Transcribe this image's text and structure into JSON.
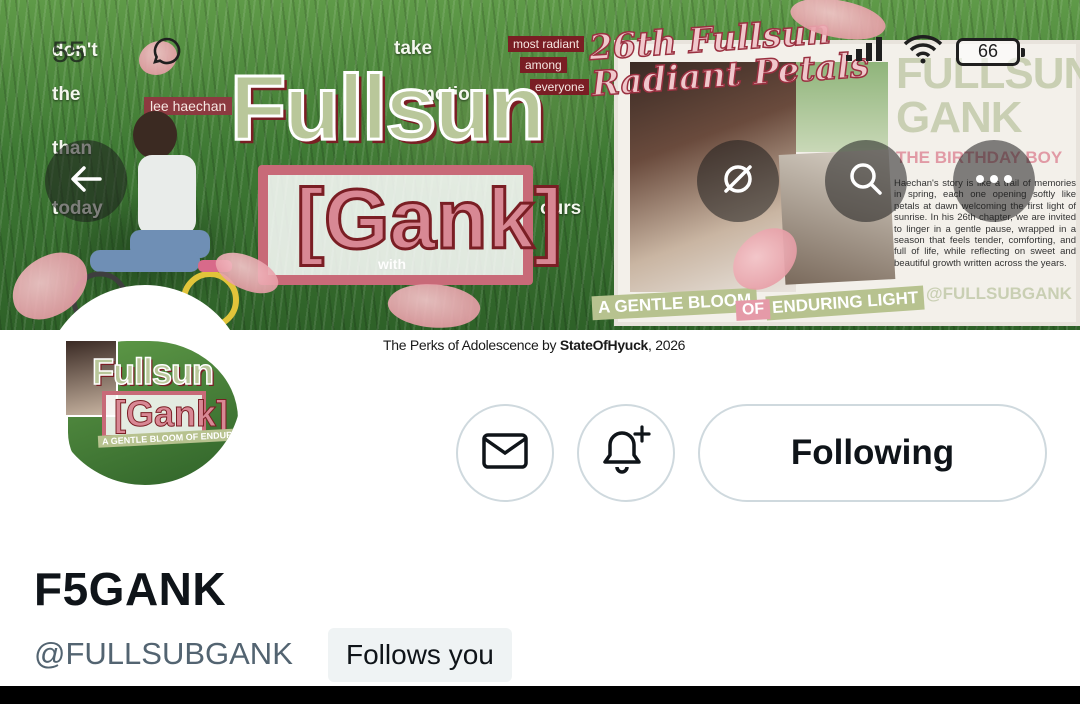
{
  "status_bar": {
    "time": "55",
    "battery": "66"
  },
  "banner": {
    "words": [
      "don't",
      "the",
      "than",
      "today",
      "take",
      "motion",
      "with",
      "ours"
    ],
    "tags": [
      "most radiant",
      "among",
      "everyone"
    ],
    "name_tag": "lee haechan",
    "logo_top": "Fullsun",
    "logo_bottom": "[Gank]",
    "poster": {
      "script_title_line1": "26th Fullsun",
      "script_title_line2": "Radiant Petals",
      "fullsun": "FULLSUN",
      "gank": "GANK",
      "birthday": "THE BIRTHDAY BOY",
      "body": "Haechan's story is like a trail of memories in spring, each one opening softly like petals at dawn welcoming the first light of sunrise. In his 26th chapter, we are invited to linger in a gentle pause, wrapped in a season that feels tender, comforting, and full of life, while reflecting on sweet and beautiful growth written across the years.",
      "handle": "@FULLSUBGANK"
    },
    "ribbon_left": "A GENTLE BLOOM",
    "ribbon_of": "OF",
    "ribbon_right": "ENDURING LIGHT",
    "credit_prefix": "The Perks of Adolescence by ",
    "credit_author": "StateOfHyuck",
    "credit_suffix": ", 2026"
  },
  "avatar": {
    "logo_top": "Fullsun",
    "logo_bottom": "[Gank]",
    "ribbon": "A GENTLE BLOOM OF ENDURING LIGHT"
  },
  "actions": {
    "following_label": "Following"
  },
  "profile": {
    "display_name": "F5GANK",
    "handle": "@FULLSUBGANK",
    "follows_you": "Follows you"
  },
  "icons": {
    "back": "arrow-left-icon",
    "grok": "grok-icon",
    "search": "search-icon",
    "more": "more-icon",
    "message": "envelope-icon",
    "notify": "bell-plus-icon"
  }
}
